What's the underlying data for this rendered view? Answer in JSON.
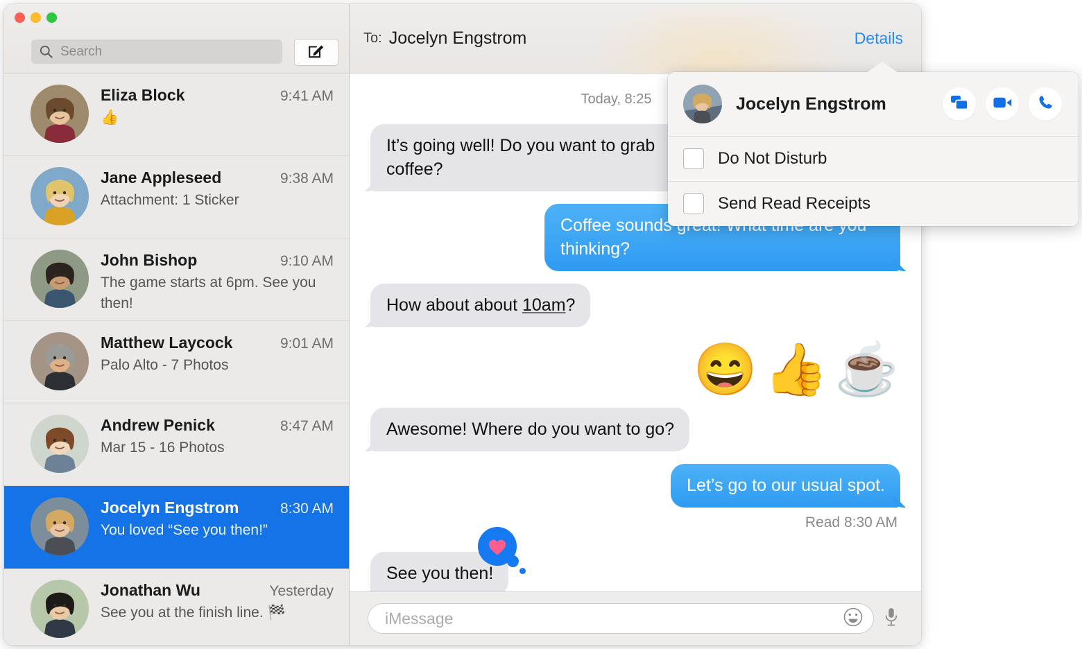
{
  "window": {
    "traffic_lights": [
      "close",
      "minimize",
      "zoom"
    ],
    "colors": {
      "accent_blue": "#1E8BFF",
      "selected_row": "#1473E6",
      "bubble_me": "#2E9BF2",
      "bubble_them": "#E5E4E9",
      "sidebar_bg": "#ECEAE8",
      "tapback_blue": "#1579F2",
      "tapback_heart": "#FF5E8F"
    }
  },
  "sidebar": {
    "search": {
      "placeholder": "Search",
      "value": "",
      "icon": "search-icon"
    },
    "compose_button": {
      "icon": "compose-icon",
      "label": ""
    },
    "conversations": [
      {
        "name": "Eliza Block",
        "time": "9:41 AM",
        "preview": "👍",
        "selected": false,
        "avatar_hue": "#9e8b6e"
      },
      {
        "name": "Jane Appleseed",
        "time": "9:38 AM",
        "preview": "Attachment: 1 Sticker",
        "selected": false,
        "avatar_hue": "#7fa8c9"
      },
      {
        "name": "John Bishop",
        "time": "9:10 AM",
        "preview": "The game starts at 6pm. See you then!",
        "selected": false,
        "avatar_hue": "#8f9a86"
      },
      {
        "name": "Matthew Laycock",
        "time": "9:01 AM",
        "preview": "Palo Alto - 7 Photos",
        "selected": false,
        "avatar_hue": "#a39486"
      },
      {
        "name": "Andrew Penick",
        "time": "8:47 AM",
        "preview": "Mar 15 - 16 Photos",
        "selected": false,
        "avatar_hue": "#cfd6cd"
      },
      {
        "name": "Jocelyn Engstrom",
        "time": "8:30 AM",
        "preview": "You loved “See you then!”",
        "selected": true,
        "avatar_hue": "#7d8e9b"
      },
      {
        "name": "Jonathan Wu",
        "time": "Yesterday",
        "preview": "See you at the finish line. 🏁",
        "selected": false,
        "avatar_hue": "#b6c8a9"
      }
    ]
  },
  "thread": {
    "to_label": "To:",
    "to_name": "Jocelyn Engstrom",
    "details_label": "Details",
    "day_stamp": "Today, 8:25",
    "messages": [
      {
        "kind": "text",
        "from": "them",
        "text": "It’s going well! Do you want to grab coffee?"
      },
      {
        "kind": "text",
        "from": "me",
        "text": "Coffee sounds great! What time are you thinking?"
      },
      {
        "kind": "text",
        "from": "them",
        "text_before": "How about about ",
        "text_link": "10am",
        "text_after": "?"
      },
      {
        "kind": "emoji",
        "from": "me",
        "emojis": [
          "😄",
          "👍",
          "☕"
        ]
      },
      {
        "kind": "text",
        "from": "them",
        "text": "Awesome! Where do you want to go?"
      },
      {
        "kind": "text",
        "from": "me",
        "text": "Let’s go to our usual spot."
      }
    ],
    "read_receipt": "Read 8:30 AM",
    "last_message": {
      "from": "them",
      "text": "See you then!",
      "tapback": "heart-tapback-icon"
    }
  },
  "compose": {
    "placeholder": "iMessage",
    "value": "",
    "emoji_button": "smiley-icon",
    "mic_button": "microphone-icon"
  },
  "details_popover": {
    "contact_name": "Jocelyn Engstrom",
    "actions": [
      {
        "name": "screen-share-icon",
        "label": "Share Screen"
      },
      {
        "name": "video-call-icon",
        "label": "FaceTime Video"
      },
      {
        "name": "phone-call-icon",
        "label": "Phone Call"
      }
    ],
    "options": [
      {
        "label": "Do Not Disturb",
        "checked": false
      },
      {
        "label": "Send Read Receipts",
        "checked": false
      }
    ]
  }
}
